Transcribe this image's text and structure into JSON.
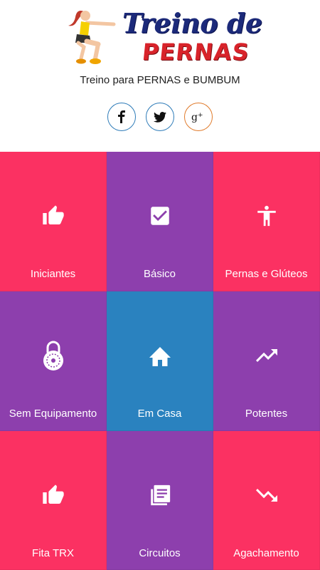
{
  "header": {
    "logo_title": "Treino de",
    "logo_sub": "PERNAS",
    "subtitle": "Treino para PERNAS e BUMBUM"
  },
  "social": [
    {
      "name": "facebook-icon",
      "glyph": "f"
    },
    {
      "name": "twitter-icon",
      "glyph": "twitter"
    },
    {
      "name": "google-plus-icon",
      "glyph": "g+"
    }
  ],
  "tiles": [
    {
      "label": "Iniciantes",
      "icon": "thumbs-up-icon",
      "color": "#fb3162"
    },
    {
      "label": "Básico",
      "icon": "checkbox-icon",
      "color": "#8d3fad"
    },
    {
      "label": "Pernas e Glúteos",
      "icon": "person-icon",
      "color": "#fb3162"
    },
    {
      "label": "Sem Equipamento",
      "icon": "lock-icon",
      "color": "#8d3fad"
    },
    {
      "label": "Em Casa",
      "icon": "home-icon",
      "color": "#2a82bf"
    },
    {
      "label": "Potentes",
      "icon": "trending-up-icon",
      "color": "#8d3fad"
    },
    {
      "label": "Fita TRX",
      "icon": "thumbs-up-icon",
      "color": "#fb3162"
    },
    {
      "label": "Circuitos",
      "icon": "article-icon",
      "color": "#8d3fad"
    },
    {
      "label": "Agachamento",
      "icon": "trending-down-icon",
      "color": "#fb3162"
    }
  ]
}
